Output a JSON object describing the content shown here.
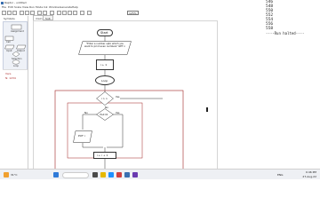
{
  "app": {
    "title": "Raptor - untitled",
    "menu": [
      "File",
      "Edit",
      "Scale",
      "View",
      "Run",
      "Mode",
      "Ink",
      "Window",
      "Generate",
      "Help"
    ],
    "zoom_value": "125%"
  },
  "palette": {
    "header": "Symbols",
    "items": [
      "Assignment",
      "Call",
      "Input",
      "Output",
      "Selection",
      "Loop"
    ]
  },
  "variables": [
    "Vars",
    "N: 1234"
  ],
  "tabs": [
    "main",
    "Sub"
  ],
  "flowchart": {
    "start": "Start",
    "input_prompt": "\"Enter a number upto which you want to print even numbers\" GET n",
    "init": "i ← 1",
    "loop": "Loop",
    "condition": "i > n",
    "yes_label": "Yes",
    "no_label": "No",
    "branch_no": "No",
    "branch_yes": "Yes",
    "inner_cond": "i%2=0",
    "output": "PUT i",
    "increment": "i ← i + 1"
  },
  "output_panel": {
    "lines": [
      "546",
      "548",
      "550",
      "552",
      "554",
      "556",
      "558",
      "----Run halted----"
    ]
  },
  "taskbar": {
    "temperature": "31°C",
    "time": "9:46 PM",
    "date": "27-Aug-22",
    "lang": "ENG"
  },
  "colors": {
    "accent": "#3a6fb0",
    "flow_stroke": "#333333",
    "loop_box": "#a02020"
  }
}
